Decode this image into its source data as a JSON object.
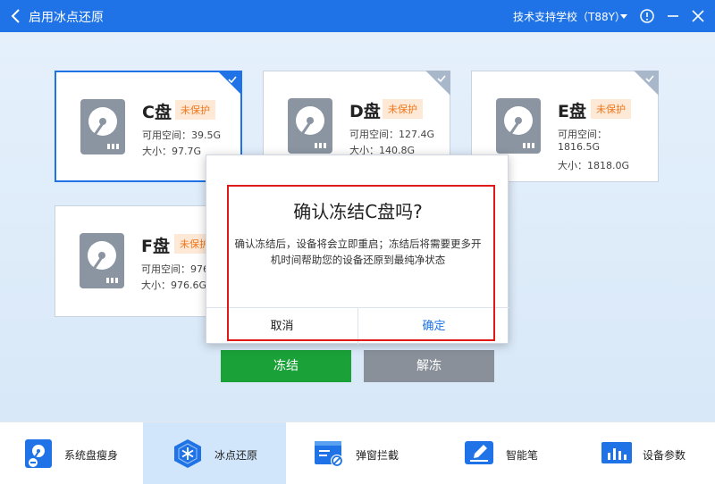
{
  "window": {
    "title": "启用冰点还原",
    "school": "技术支持学校（T88Y）"
  },
  "disks": [
    {
      "name": "C盘",
      "status": "未保护",
      "free": "可用空间：39.5G",
      "size": "大小：97.7G",
      "selected": true
    },
    {
      "name": "D盘",
      "status": "未保护",
      "free": "可用空间：127.4G",
      "size": "大小：140.8G",
      "selected": false
    },
    {
      "name": "E盘",
      "status": "未保护",
      "free": "可用空间：",
      "free2": "1816.5G",
      "size": "大小：1818.0G",
      "selected": false
    },
    {
      "name": "F盘",
      "status": "未保护",
      "free": "可用空间：976",
      "size": "大小：976.6G",
      "selected": false
    }
  ],
  "actions": {
    "freeze": "冻结",
    "unfreeze": "解冻"
  },
  "dialog": {
    "title": "确认冻结C盘吗?",
    "body": "确认冻结后，设备将会立即重启；冻结后将需要更多开机时间帮助您的设备还原到最纯净状态",
    "cancel": "取消",
    "confirm": "确定"
  },
  "nav": [
    {
      "label": "系统盘瘦身",
      "icon": "disk-slim-icon",
      "active": false
    },
    {
      "label": "冰点还原",
      "icon": "snowflake-hexagon-icon",
      "active": true
    },
    {
      "label": "弹窗拦截",
      "icon": "popup-block-icon",
      "active": false
    },
    {
      "label": "智能笔",
      "icon": "smart-pen-icon",
      "active": false
    },
    {
      "label": "设备参数",
      "icon": "device-params-icon",
      "active": false
    }
  ],
  "colors": {
    "primary": "#1f73e6",
    "freeze": "#1aa138",
    "unfreeze": "#8a909a",
    "warning_text": "#f0771d",
    "warning_bg": "#fde9d6",
    "highlight": "#e01919"
  }
}
